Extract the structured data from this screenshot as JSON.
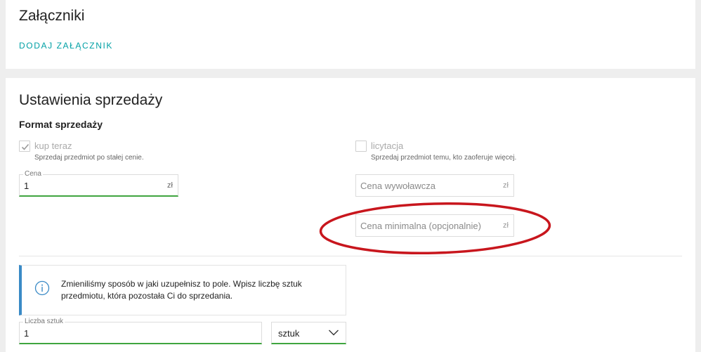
{
  "attachments": {
    "title": "Załączniki",
    "add_link": "DODAJ ZAŁĄCZNIK"
  },
  "sale_settings": {
    "title": "Ustawienia sprzedaży",
    "format_heading": "Format sprzedaży",
    "buy_now": {
      "label": "kup teraz",
      "description": "Sprzedaj przedmiot po stałej cenie.",
      "checked": true
    },
    "auction": {
      "label": "licytacja",
      "description": "Sprzedaj przedmiot temu, kto zaoferuje więcej.",
      "checked": false
    },
    "price_field": {
      "legend": "Cena",
      "value": "1",
      "unit": "zł"
    },
    "starting_price_field": {
      "placeholder": "Cena wywoławcza",
      "unit": "zł"
    },
    "min_price_field": {
      "placeholder": "Cena minimalna (opcjonalnie)",
      "unit": "zł"
    },
    "info_message": "Zmieniliśmy sposób w jaki uzupełnisz to pole. Wpisz liczbę sztuk przedmiotu, która pozostała Ci do sprzedania.",
    "quantity_field": {
      "legend": "Liczba sztuk",
      "value": "1"
    },
    "unit_select": {
      "selected": "sztuk"
    }
  },
  "colors": {
    "accent_link": "#00a0a5",
    "active_underline": "#3fa53f",
    "info_border": "#3a8ac6",
    "annotation": "#c8161d"
  }
}
